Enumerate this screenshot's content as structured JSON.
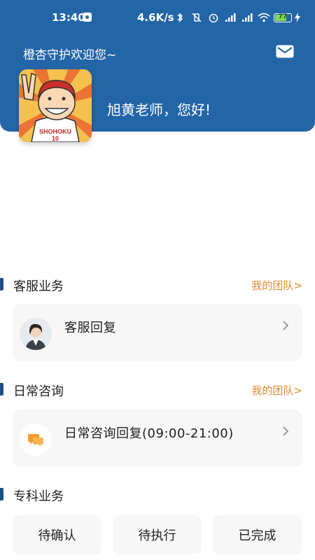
{
  "status_bar": {
    "time": "13:40",
    "speed": "4.6K/s",
    "battery": "77",
    "battery_level": 0.77,
    "icons": [
      "bluetooth-icon",
      "vibrate-off-icon",
      "alarm-icon",
      "signal-icon",
      "signal-icon",
      "wifi-icon",
      "battery-icon",
      "charging-icon"
    ]
  },
  "header": {
    "welcome": "橙杏守护欢迎您~",
    "greeting": "旭黄老师，您好!",
    "mail_icon": "mail-icon"
  },
  "sections": {
    "customer_service": {
      "title": "客服业务",
      "link": "我的团队>"
    },
    "daily_consult": {
      "title": "日常咨询",
      "link": "我的团队>"
    },
    "specialty": {
      "title": "专科业务"
    }
  },
  "cards": {
    "customer_reply": {
      "label": "客服回复"
    },
    "consult_reply": {
      "label": "日常咨询回复(09:00-21:00)"
    }
  },
  "tasks": [
    "待确认",
    "待执行",
    "已完成"
  ],
  "colors": {
    "header_bg": "#2366a8",
    "accent_link": "#e08a2e",
    "section_bar": "#1d4f86",
    "card_bg": "#f7f7f7"
  }
}
